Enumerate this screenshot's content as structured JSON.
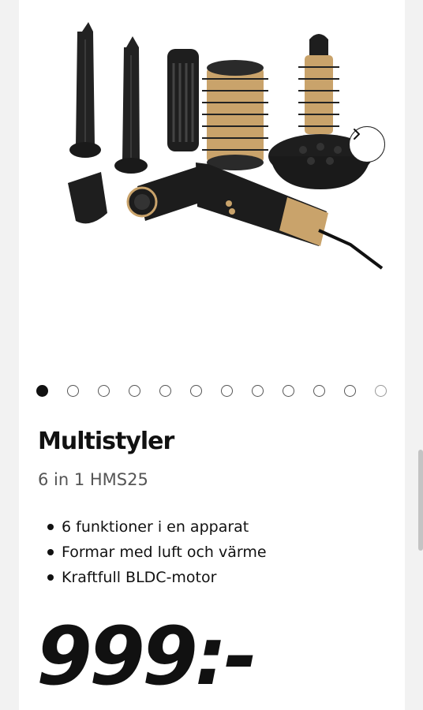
{
  "product": {
    "title": "Multistyler",
    "subtitle": "6 in 1 HMS25",
    "features": [
      "6 funktioner i en apparat",
      "Formar med luft och värme",
      "Kraftfull BLDC-motor"
    ],
    "price": "999:-"
  },
  "carousel": {
    "slide_count": 12,
    "active_index": 0,
    "next_icon": "chevron-right-icon"
  },
  "colors": {
    "accent_gold": "#c9a36b",
    "device_black": "#1c1c1c"
  }
}
